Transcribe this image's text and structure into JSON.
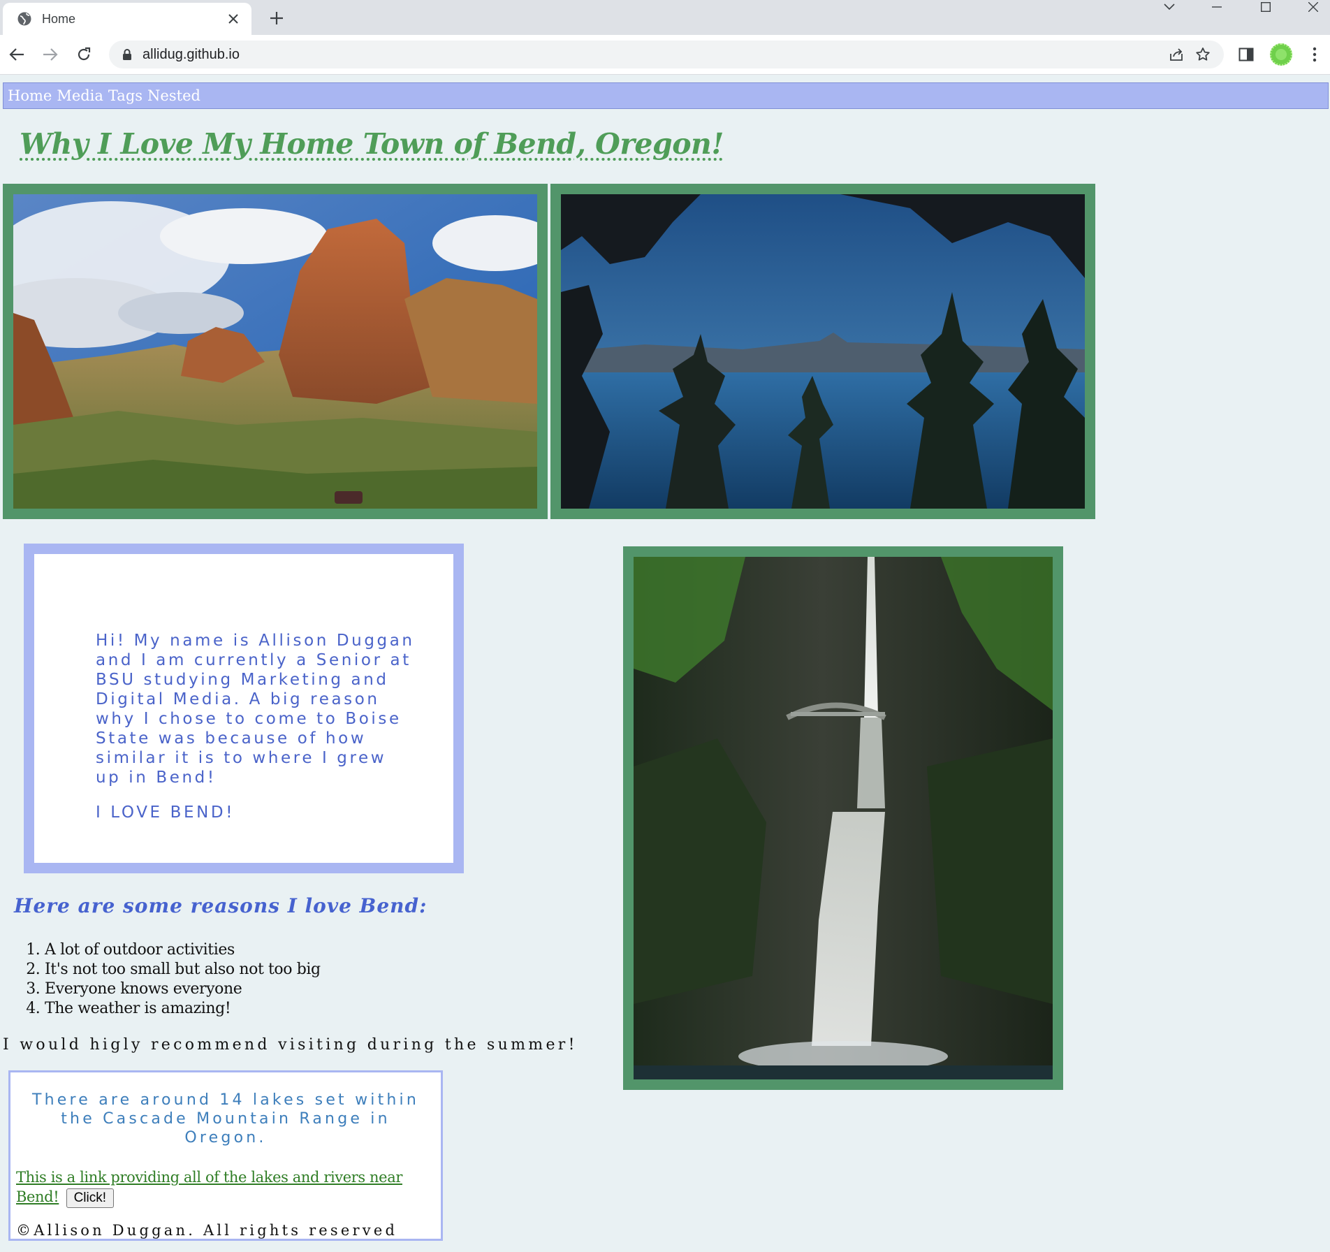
{
  "browser": {
    "tab_title": "Home",
    "url": "allidug.github.io"
  },
  "nav": {
    "items": [
      "Home",
      "Media",
      "Tags",
      "Nested"
    ]
  },
  "page": {
    "title": "Why I Love My Home Town of Bend, Oregon!",
    "bio": "Hi! My name is Allison Duggan and I am currently a Senior at BSU studying Marketing and Digital Media. A big reason why I chose to come to Boise State was because of how similar it is to where I grew up in Bend!",
    "bio_love": "I LOVE BEND!",
    "reasons_heading": "Here are some reasons I love Bend:",
    "reasons": [
      "A lot of outdoor activities",
      "It's not too small but also not too big",
      "Everyone knows everyone",
      "The weather is amazing!"
    ],
    "recommend": "I would higly recommend visiting during the summer!",
    "lakes_text": "There are around 14 lakes set within the Cascade Mountain Range in Oregon.",
    "lakes_link": "This is a link providing all of the lakes and rivers near Bend!",
    "click_button": "Click!",
    "copyright": "©Allison Duggan. All rights reserved"
  },
  "colors": {
    "page_bg": "#e9f1f3",
    "nav_bg": "#a9b6f2",
    "title_green": "#4f9d58",
    "frame_green": "#52956a",
    "bio_blue": "#4a63c9",
    "lakes_blue": "#3d7ebb",
    "link_green": "#2f7d25"
  },
  "icons": {
    "tab": "globe-icon",
    "toolbar": [
      "back-arrow-icon",
      "forward-arrow-icon",
      "reload-icon",
      "lock-icon",
      "share-icon",
      "star-icon",
      "side-panel-icon",
      "profile-avatar",
      "more-menu-icon"
    ]
  }
}
